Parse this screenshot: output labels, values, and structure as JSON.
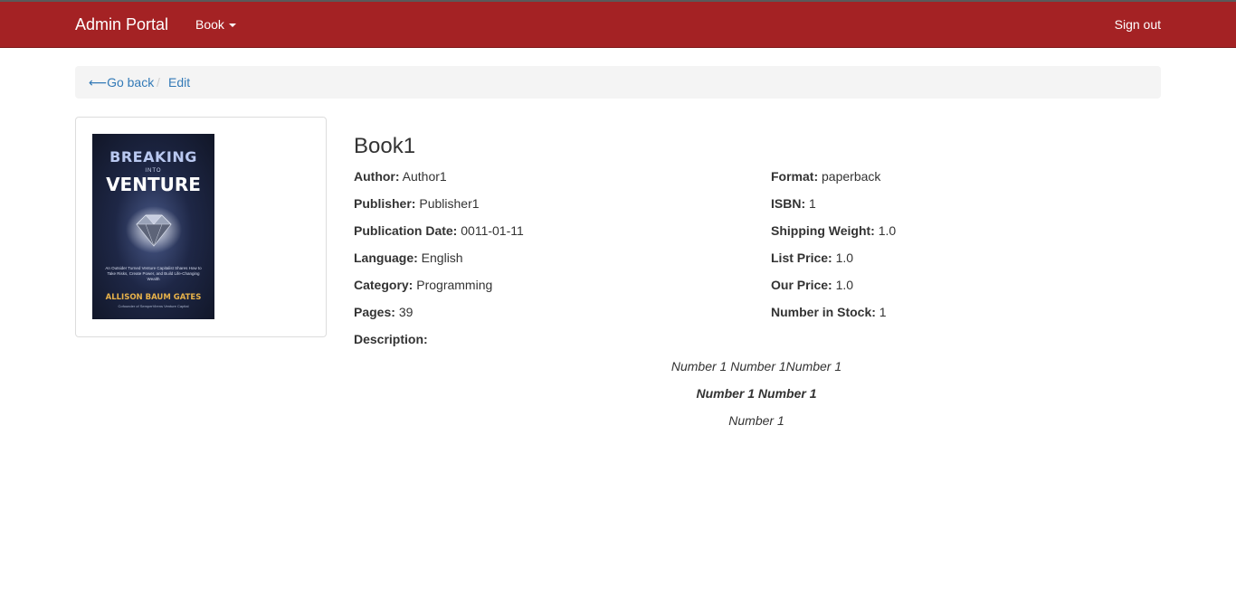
{
  "nav": {
    "brand": "Admin Portal",
    "book_menu": "Book",
    "signout": "Sign out"
  },
  "breadcrumb": {
    "back_label": "⟵Go back",
    "separator": "/",
    "edit_label": "Edit"
  },
  "cover": {
    "title_line1": "BREAKING",
    "title_line2": "INTO",
    "title_line3": "VENTURE",
    "blurb": "An Outsider Turned Venture Capitalist Shares How to Take Risks, Create Power, and Build Life-Changing Wealth",
    "author": "ALLISON BAUM GATES",
    "tagline": "Cofounder of SemperVirens Venture Capital"
  },
  "book": {
    "title": "Book1",
    "left_fields": [
      {
        "label": "Author:",
        "value": "Author1"
      },
      {
        "label": "Publisher:",
        "value": "Publisher1"
      },
      {
        "label": "Publication Date:",
        "value": "0011-01-11"
      },
      {
        "label": "Language:",
        "value": "English"
      },
      {
        "label": "Category:",
        "value": "Programming"
      },
      {
        "label": "Pages:",
        "value": "39"
      },
      {
        "label": "Description:",
        "value": ""
      }
    ],
    "right_fields": [
      {
        "label": "Format:",
        "value": "paperback"
      },
      {
        "label": "ISBN:",
        "value": "1"
      },
      {
        "label": "Shipping Weight:",
        "value": "1.0"
      },
      {
        "label": "List Price:",
        "value": "1.0"
      },
      {
        "label": "Our Price:",
        "value": "1.0"
      },
      {
        "label": "Number in Stock:",
        "value": "1"
      }
    ],
    "description_lines": [
      "Number 1 Number 1Number 1",
      "Number 1 Number 1",
      "Number 1"
    ]
  },
  "colors": {
    "navbar": "#a42224",
    "link": "#337ab7",
    "breadcrumb_bg": "#f4f4f4"
  }
}
